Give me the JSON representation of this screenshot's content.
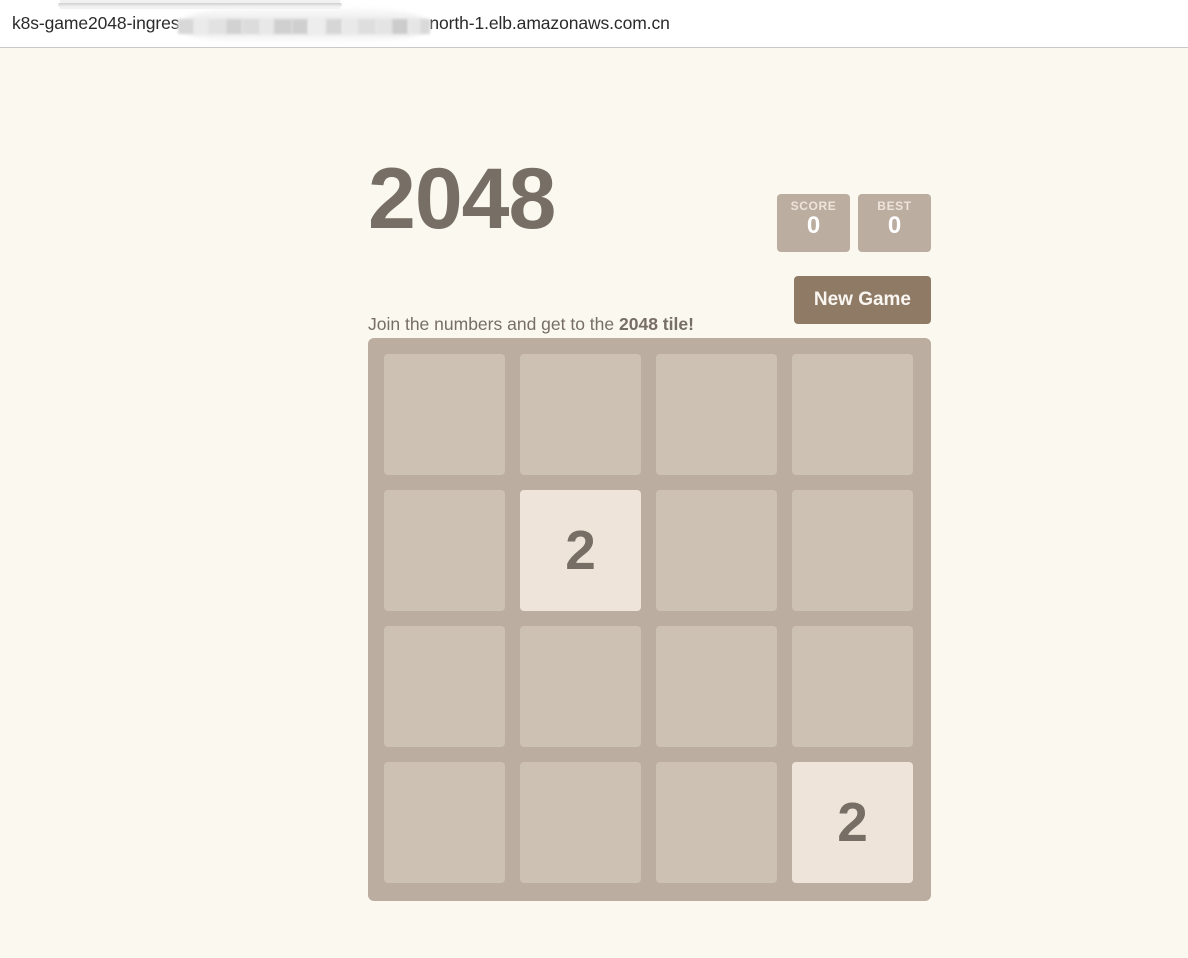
{
  "browser": {
    "url_prefix": "k8s-game2048-ingres",
    "url_redacted_placeholder": "",
    "url_suffix": "north-1.elb.amazonaws.com.cn"
  },
  "game": {
    "title": "2048",
    "intro_prefix": "Join the numbers and get to the ",
    "intro_highlight": "2048 tile!",
    "restart_label": "New Game",
    "score": {
      "label": "SCORE",
      "value": "0"
    },
    "best": {
      "label": "BEST",
      "value": "0"
    },
    "board": {
      "rows": 4,
      "cols": 4,
      "cells": [
        [
          "",
          "",
          "",
          ""
        ],
        [
          "",
          "2",
          "",
          ""
        ],
        [
          "",
          "",
          "",
          ""
        ],
        [
          "",
          "",
          "",
          "2"
        ]
      ]
    }
  },
  "colors": {
    "page_background": "#faf8ef",
    "board_background": "#bbada0",
    "empty_cell": "#cdc1b4",
    "tile_2_background": "#eee4da",
    "text_dark": "#776e65",
    "button_background": "#8f7a66",
    "button_text": "#f9f6f2"
  }
}
